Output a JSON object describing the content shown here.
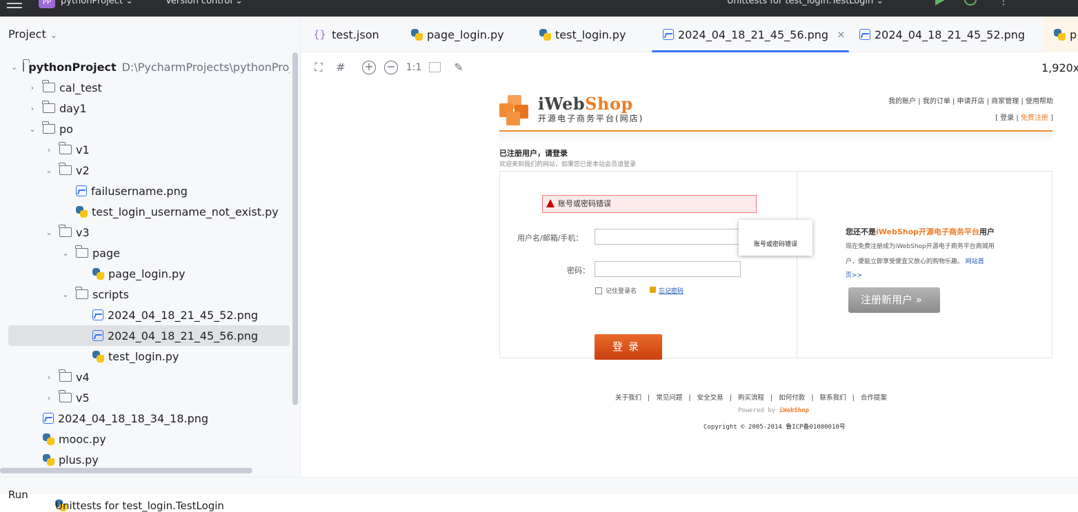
{
  "titlebar": {
    "project_badge": "PP",
    "project_name": "pythonProject",
    "vcs": "Version control",
    "run_config": "Unittests for test_login.TestLogin"
  },
  "project_panel": {
    "title": "Project",
    "tree": [
      {
        "label": "pythonProject",
        "path": "D:\\PycharmProjects\\pythonProj",
        "type": "folder",
        "expanded": true
      },
      {
        "label": "cal_test",
        "type": "folder",
        "expanded": false
      },
      {
        "label": "day1",
        "type": "folder",
        "expanded": false
      },
      {
        "label": "po",
        "type": "folder",
        "expanded": true
      },
      {
        "label": "v1",
        "type": "folder",
        "expanded": false
      },
      {
        "label": "v2",
        "type": "folder",
        "expanded": true
      },
      {
        "label": "failusername.png",
        "type": "image"
      },
      {
        "label": "test_login_username_not_exist.py",
        "type": "python"
      },
      {
        "label": "v3",
        "type": "folder",
        "expanded": true
      },
      {
        "label": "page",
        "type": "folder",
        "expanded": true
      },
      {
        "label": "page_login.py",
        "type": "python"
      },
      {
        "label": "scripts",
        "type": "folder",
        "expanded": true
      },
      {
        "label": "2024_04_18_21_45_52.png",
        "type": "image"
      },
      {
        "label": "2024_04_18_21_45_56.png",
        "type": "image",
        "selected": true
      },
      {
        "label": "test_login.py",
        "type": "python"
      },
      {
        "label": "v4",
        "type": "folder",
        "expanded": false
      },
      {
        "label": "v5",
        "type": "folder",
        "expanded": false
      },
      {
        "label": "2024_04_18_18_34_18.png",
        "type": "image"
      },
      {
        "label": "mooc.py",
        "type": "python"
      },
      {
        "label": "plus.py",
        "type": "python"
      }
    ]
  },
  "tabs": [
    {
      "label": "test.json",
      "icon": "json-icon"
    },
    {
      "label": "page_login.py",
      "icon": "python-icon"
    },
    {
      "label": "test_login.py",
      "icon": "python-icon"
    },
    {
      "label": "2024_04_18_21_45_56.png",
      "icon": "image-icon",
      "active": true
    },
    {
      "label": "2024_04_18_21_45_52.png",
      "icon": "image-icon"
    },
    {
      "label": "p",
      "icon": "python-icon"
    }
  ],
  "image_toolbar": {
    "actual_size": "1:1",
    "image_size": "1,920x"
  },
  "webshot": {
    "logo_main": "iWeb",
    "logo_accent": "Shop",
    "logo_sub": "开源电子商务平台(网店)",
    "topnav": "我的账户 |  我的订单 |  申请开店 |  商家管理 |  使用帮助",
    "login_link": "登录",
    "register_link": "免费注册",
    "bracket_open": "[",
    "bracket_sep": "|",
    "bracket_close": "]",
    "section_title": "已注册用户，请登录",
    "section_sub": "欢迎来到我们的网站，如果您已是本站会员请登录",
    "error_msg": "账号或密码错误",
    "username_label": "用户名/邮箱/手机：",
    "password_label": "密码：",
    "tooltip": "账号或密码错误",
    "remember": "记住登录名",
    "forgot": "忘记密码",
    "login_btn": "登录",
    "right_title_a": "您还不是",
    "right_title_b": "iWebShop开源电子商务平台",
    "right_title_c": "用户",
    "right_line1": "现在免费注册成为iWebShop开源电子商务平台商城用",
    "right_line2a": "户，便能立即享受便宜又放心的购物乐趣。",
    "right_line2b": "网站首",
    "right_line3": "页>>",
    "register_btn": "注册新用户 »",
    "footer_links": "关于我们   |   常见问题   |   安全交易   |   购买流程   |   如何付款   |   联系我们   |   合作提案",
    "powered_a": "Powered by ",
    "powered_b": "iWebShop",
    "copyright": "Copyright © 2005-2014 鲁ICP备01000010号"
  },
  "bottombar": {
    "run_label": "Run",
    "run_config": "Unittests for test_login.TestLogin"
  }
}
